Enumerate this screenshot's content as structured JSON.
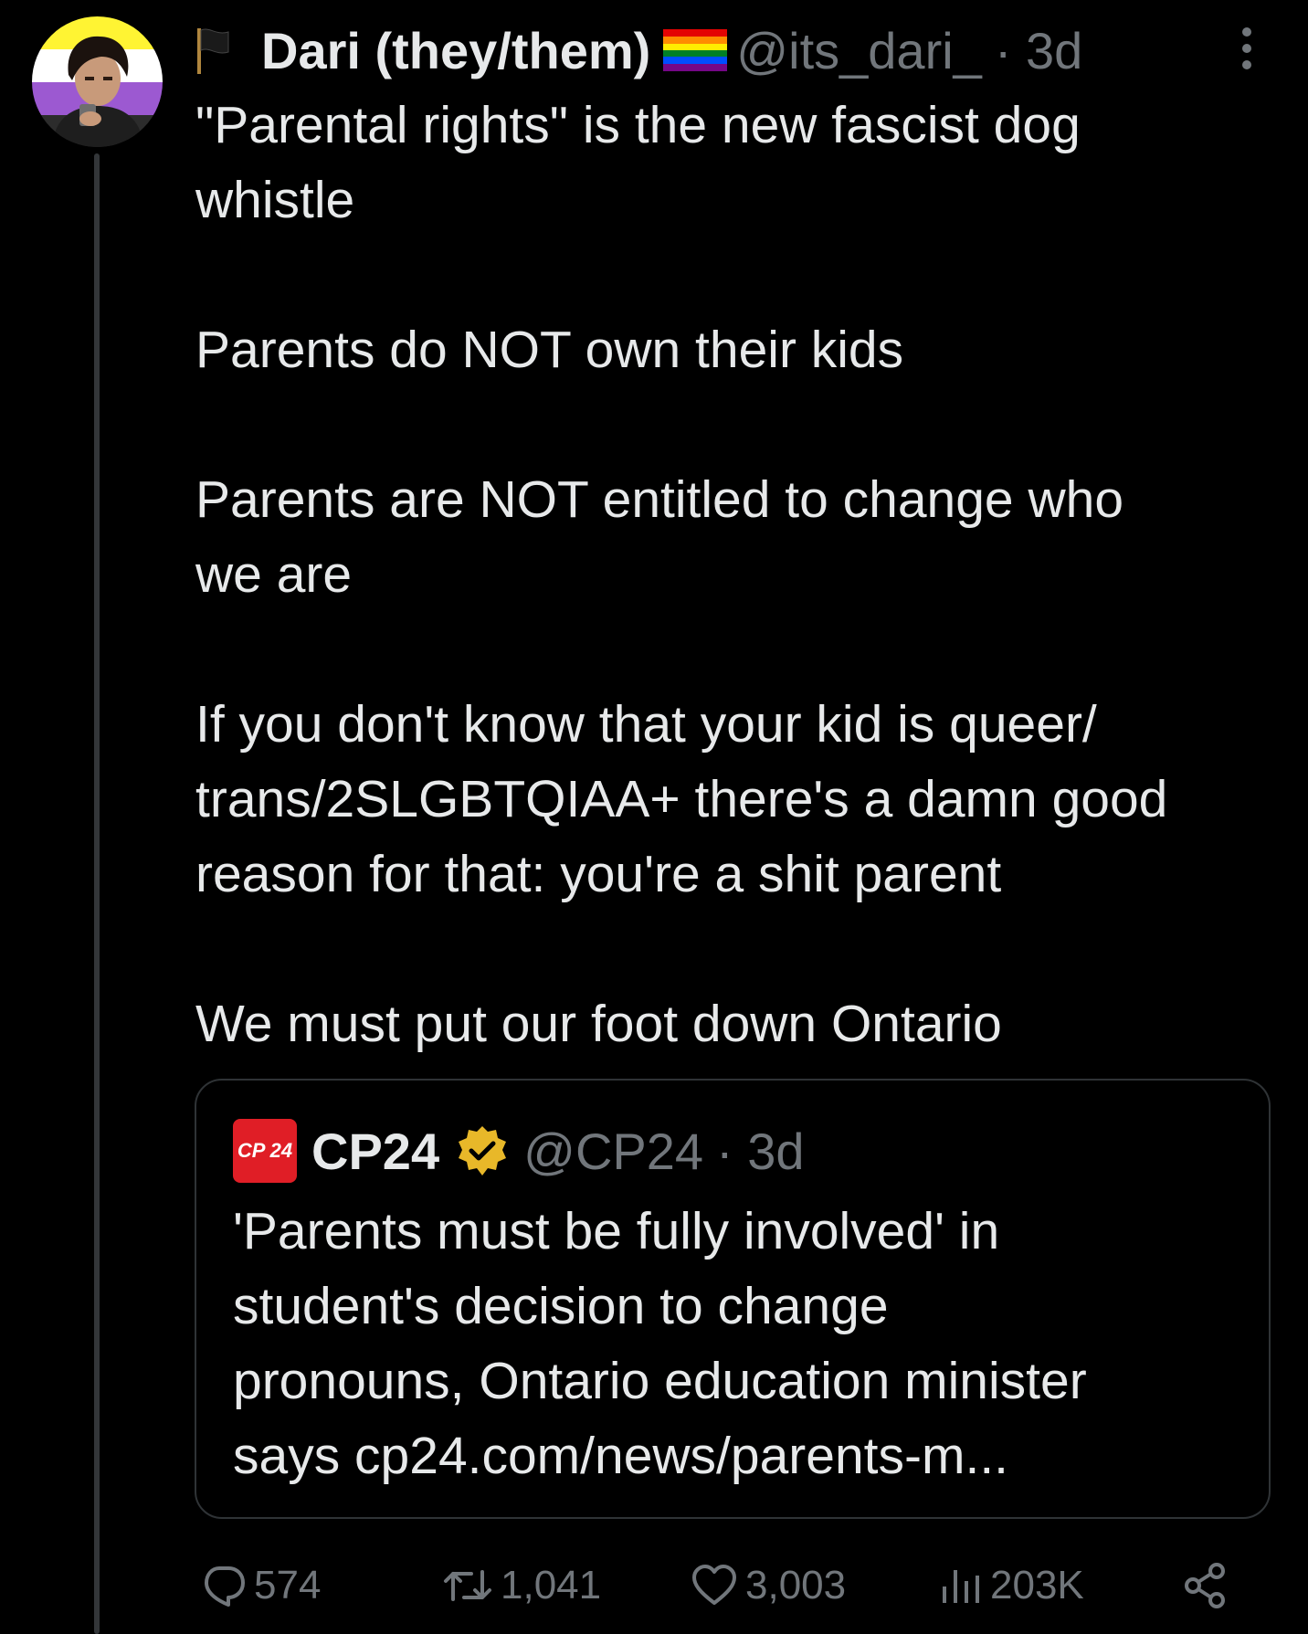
{
  "author": {
    "name": "Dari (they/them)",
    "handle": "@its_dari_",
    "time": "· 3d"
  },
  "tweet": {
    "lines": [
      "\"Parental rights\" is the new fascist dog",
      "whistle",
      "",
      "Parents do NOT own their kids",
      "",
      "Parents are NOT entitled to change who",
      "we are",
      "",
      "If you don't know that your kid is queer/",
      "trans/2SLGBTQIAA+ there's a damn good",
      "reason for that: you're a shit parent",
      "",
      "We must put our foot down Ontario"
    ]
  },
  "quote": {
    "logo_text": "CP 24",
    "name": "CP24",
    "handle": "@CP24",
    "time": "· 3d",
    "lines": [
      "'Parents must be fully involved' in",
      "student's decision to change",
      "pronouns, Ontario education minister",
      "says  cp24.com/news/parents-m..."
    ]
  },
  "actions": {
    "replies": "574",
    "reposts": "1,041",
    "likes": "3,003",
    "views": "203K"
  },
  "colors": {
    "background": "#000000",
    "text": "#e7e9ea",
    "secondary": "#71767b",
    "border": "#2f3336",
    "verified": "#e8b829",
    "cp24_red": "#e01e26"
  },
  "icons": [
    "black-flag-icon",
    "rainbow-flag-icon",
    "more-icon",
    "verified-badge-icon",
    "reply-icon",
    "repost-icon",
    "like-icon",
    "views-icon",
    "share-icon"
  ]
}
